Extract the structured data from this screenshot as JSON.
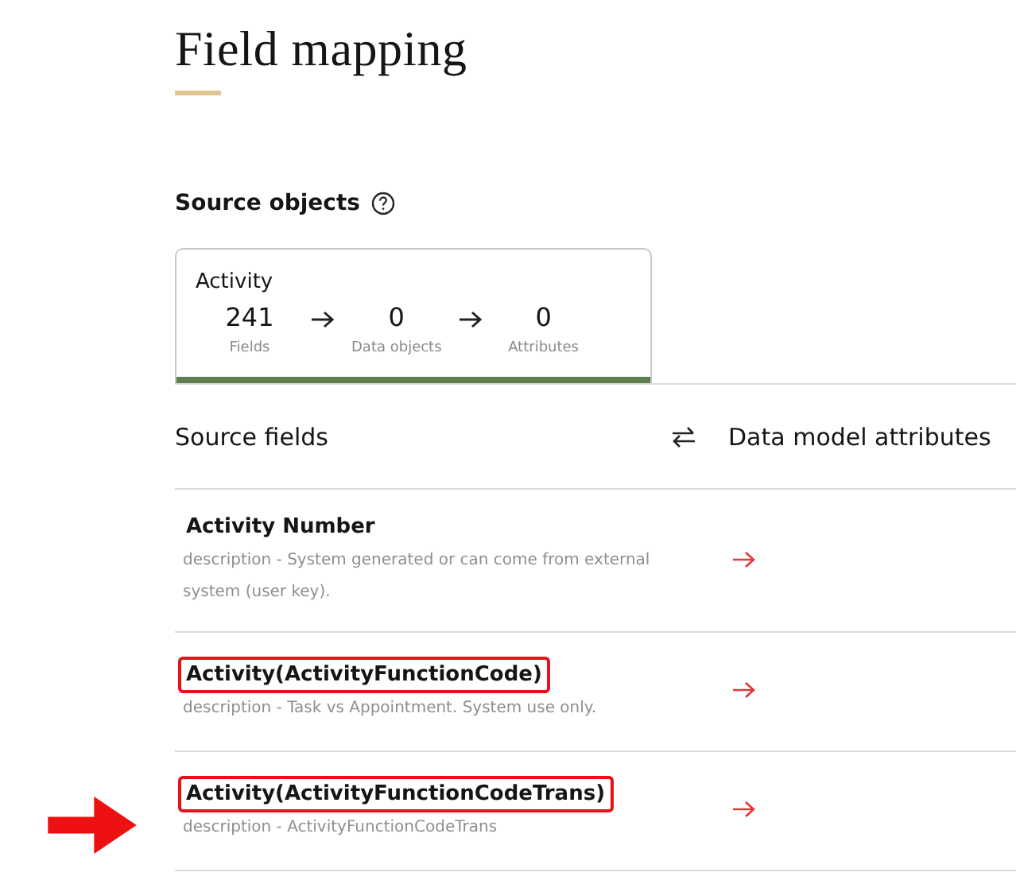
{
  "page": {
    "title": "Field mapping"
  },
  "source_objects": {
    "heading": "Source objects",
    "card": {
      "name": "Activity",
      "selected": true,
      "stats": [
        {
          "value": "241",
          "label": "Fields"
        },
        {
          "value": "0",
          "label": "Data objects"
        },
        {
          "value": "0",
          "label": "Attributes"
        }
      ]
    }
  },
  "mapping": {
    "columns": [
      "Source fields",
      "Data model attributes"
    ],
    "rows": [
      {
        "name": "Activity Number",
        "description": "description - System generated or can come from external system (user key).",
        "highlighted": false,
        "pointed": false
      },
      {
        "name": "Activity(ActivityFunctionCode)",
        "description": "description - Task vs Appointment. System use only.",
        "highlighted": true,
        "pointed": false
      },
      {
        "name": "Activity(ActivityFunctionCodeTrans)",
        "description": "description - ActivityFunctionCodeTrans",
        "highlighted": true,
        "pointed": true
      }
    ]
  }
}
